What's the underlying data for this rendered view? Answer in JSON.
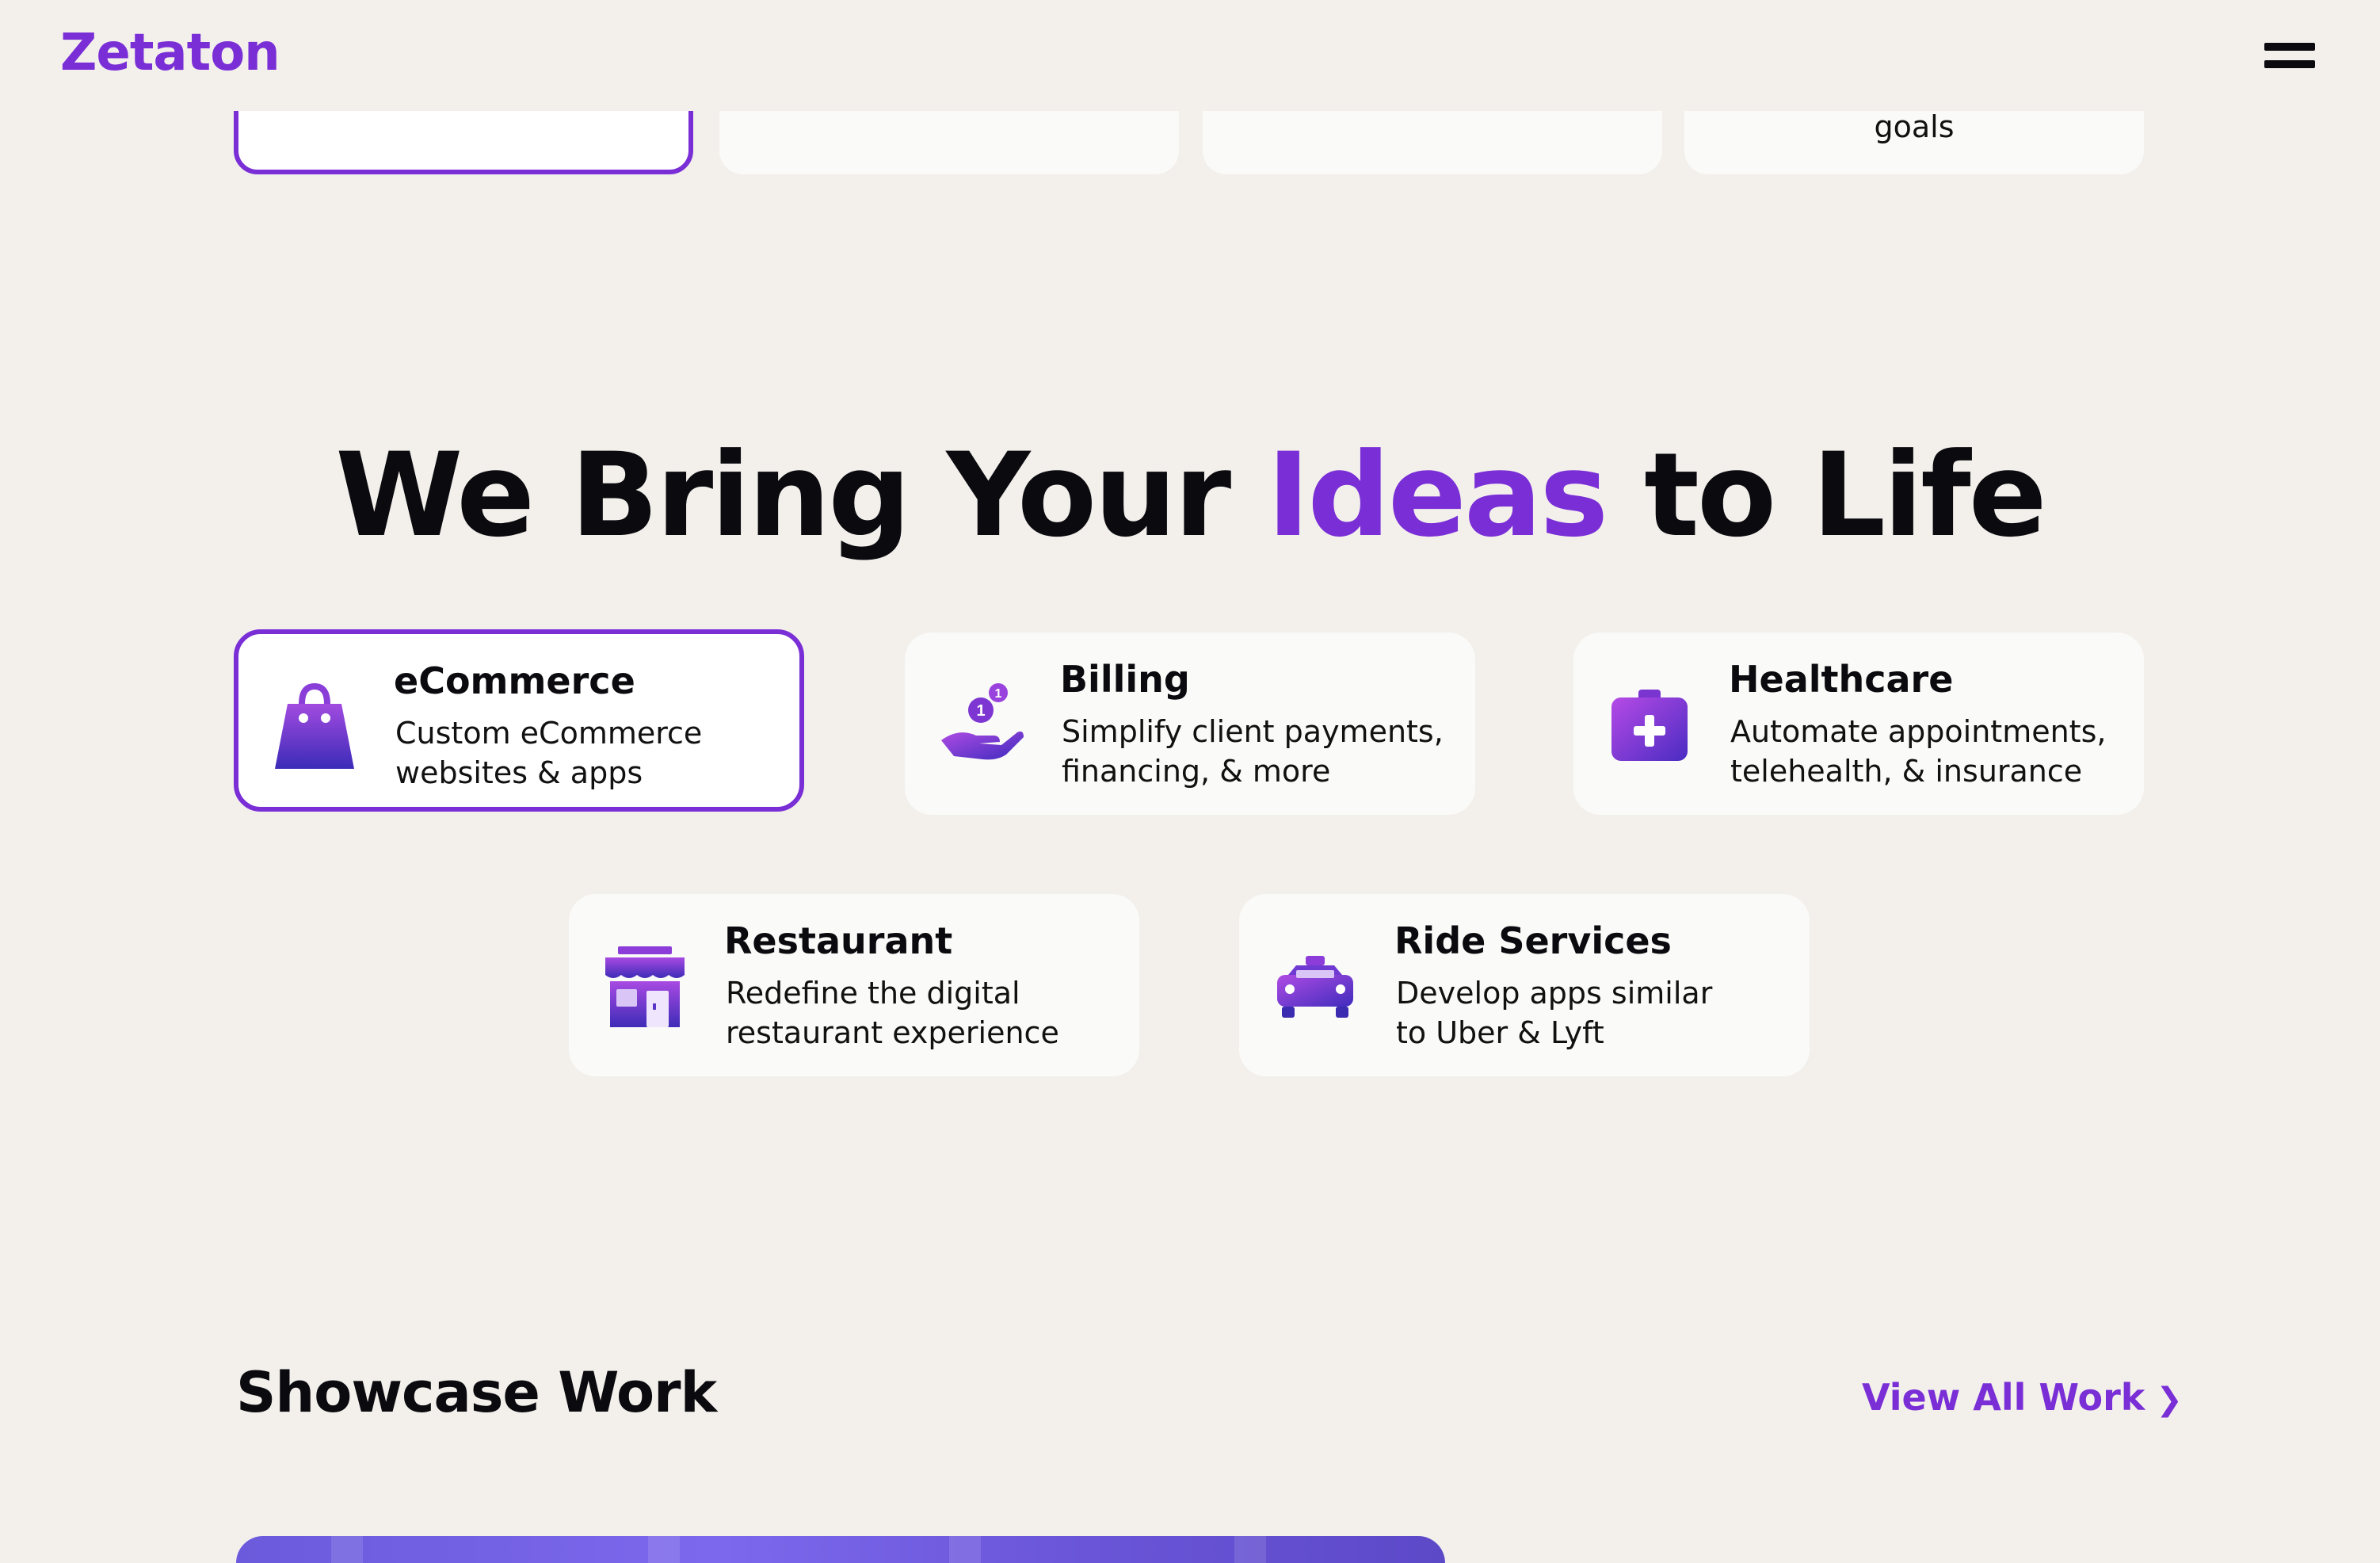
{
  "header": {
    "logo": "Zetaton",
    "menu_icon": "hamburger-menu-icon"
  },
  "top_cards": {
    "items": [
      {
        "text": ""
      },
      {
        "text": ""
      },
      {
        "text": ""
      },
      {
        "text": "goals"
      }
    ]
  },
  "hero": {
    "headline_part1": "We Bring Your ",
    "headline_accent": "Ideas",
    "headline_part2": " to Life"
  },
  "features": {
    "items": [
      {
        "title": "eCommerce",
        "desc_line1": "Custom eCommerce",
        "desc_line2": "websites & apps",
        "icon": "shopping-bag-icon",
        "active": true
      },
      {
        "title": "Billing",
        "desc_line1": "Simplify client payments,",
        "desc_line2": "financing, & more",
        "icon": "hand-coins-icon",
        "active": false
      },
      {
        "title": "Healthcare",
        "desc_line1": "Automate appointments,",
        "desc_line2": "telehealth, & insurance",
        "icon": "medical-kit-icon",
        "active": false
      },
      {
        "title": "Restaurant",
        "desc_line1": "Redefine the digital",
        "desc_line2": "restaurant experience",
        "icon": "storefront-icon",
        "active": false
      },
      {
        "title": "Ride Services",
        "desc_line1": "Develop apps similar",
        "desc_line2": "to Uber & Lyft",
        "icon": "taxi-icon",
        "active": false
      }
    ]
  },
  "showcase": {
    "title": "Showcase Work",
    "view_all_label": "View All Work",
    "view_all_chevron": "❯"
  },
  "colors": {
    "accent": "#7a2fd6",
    "background": "#f3f0ec",
    "card": "#fafaf8",
    "text": "#0b0b0f"
  }
}
